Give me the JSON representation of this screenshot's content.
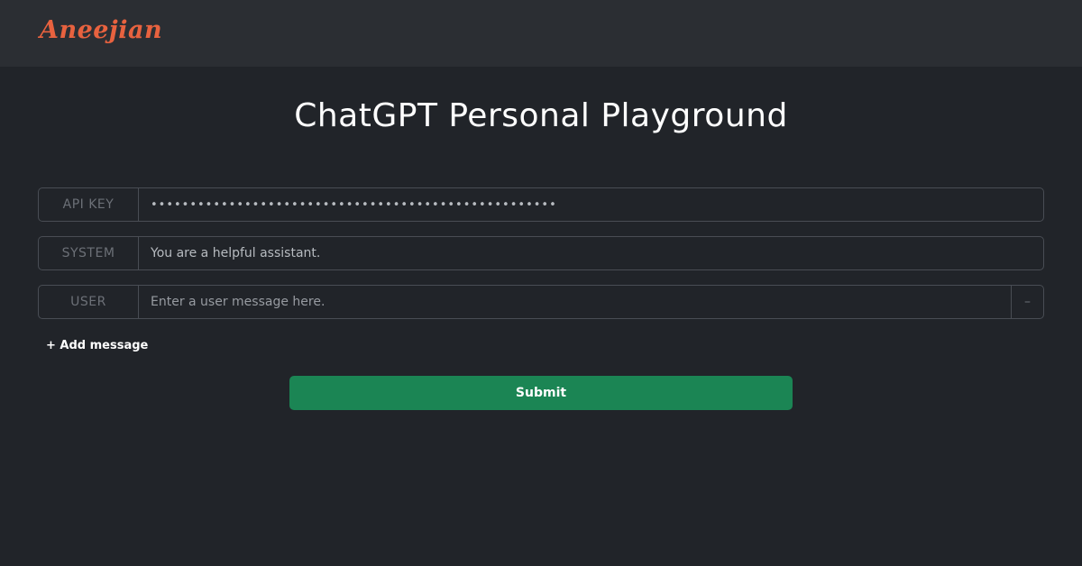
{
  "brand": {
    "name": "Aneejian",
    "color": "#e8623f"
  },
  "page": {
    "title": "ChatGPT Personal Playground"
  },
  "form": {
    "api_key": {
      "label": "API KEY",
      "value": "••••••••••••••••••••••••••••••••••••••••••••••••••••"
    },
    "system": {
      "label": "SYSTEM",
      "value": "You are a helpful assistant."
    },
    "messages": [
      {
        "label": "USER",
        "value": "",
        "placeholder": "Enter a user message here.",
        "remove_label": "–"
      }
    ],
    "add_message_label": "+ Add message",
    "submit_label": "Submit"
  },
  "colors": {
    "background": "#212429",
    "navbar": "#2b2e33",
    "submit": "#1b8554",
    "border": "#494d54"
  }
}
